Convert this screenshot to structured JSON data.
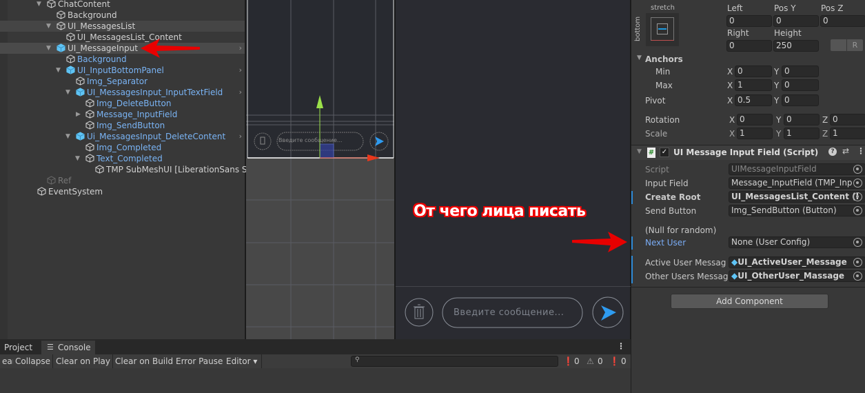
{
  "hierarchy": {
    "items": [
      {
        "label": "ChatContent",
        "depth": 0,
        "expanded": true,
        "prefab": false,
        "color": "normal"
      },
      {
        "label": "Background",
        "depth": 1,
        "prefab": false,
        "color": "normal"
      },
      {
        "label": "UI_MessagesList",
        "depth": 1,
        "expanded": true,
        "prefab": false,
        "color": "normal",
        "hover": true
      },
      {
        "label": "UI_MessagesList_Content",
        "depth": 2,
        "prefab": false,
        "color": "normal"
      },
      {
        "label": "UI_MessageInput",
        "depth": 1,
        "expanded": true,
        "prefab": true,
        "color": "normal",
        "selected": true,
        "chevron": true
      },
      {
        "label": "Background",
        "depth": 2,
        "prefab": false,
        "color": "blue"
      },
      {
        "label": "UI_InputBottomPanel",
        "depth": 2,
        "expanded": true,
        "prefab": true,
        "color": "blue",
        "chevron": true
      },
      {
        "label": "Img_Separator",
        "depth": 3,
        "prefab": false,
        "color": "blue"
      },
      {
        "label": "UI_MessagesInput_InputTextField",
        "depth": 3,
        "expanded": true,
        "prefab": true,
        "color": "blue",
        "chevron": true
      },
      {
        "label": "Img_DeleteButton",
        "depth": 4,
        "prefab": false,
        "color": "blue"
      },
      {
        "label": "Message_InputField",
        "depth": 4,
        "collapsed": true,
        "prefab": false,
        "color": "blue"
      },
      {
        "label": "Img_SendButton",
        "depth": 4,
        "prefab": false,
        "color": "blue"
      },
      {
        "label": "Ui_MessagesInput_DeleteContent",
        "depth": 3,
        "expanded": true,
        "prefab": true,
        "color": "blue",
        "chevron": true
      },
      {
        "label": "Img_Completed",
        "depth": 4,
        "prefab": false,
        "color": "blue"
      },
      {
        "label": "Text_Completed",
        "depth": 4,
        "expanded": true,
        "prefab": false,
        "color": "blue"
      },
      {
        "label": "TMP SubMeshUI [LiberationSans SI",
        "depth": 5,
        "prefab": false,
        "color": "normal"
      },
      {
        "label": "Ref",
        "depth": 0,
        "prefab": false,
        "color": "dim"
      },
      {
        "label": "EventSystem",
        "depth": -1,
        "prefab": false,
        "color": "normal"
      }
    ]
  },
  "scene": {
    "placeholder": "Введите сообщение..."
  },
  "game": {
    "placeholder": "Введите сообщение..."
  },
  "annotation": {
    "text": "От чего лица писать"
  },
  "inspector": {
    "anchor_preset": {
      "horizontal": "stretch",
      "vertical": "bottom"
    },
    "rect": {
      "left_label": "Left",
      "left": "0",
      "posy_label": "Pos Y",
      "posy": "0",
      "posz_label": "Pos Z",
      "posz": "0",
      "right_label": "Right",
      "right": "0",
      "height_label": "Height",
      "height": "250",
      "r_button": "R"
    },
    "anchors": {
      "label": "Anchors",
      "min_label": "Min",
      "min_x": "0",
      "min_y": "0",
      "max_label": "Max",
      "max_x": "1",
      "max_y": "0"
    },
    "pivot": {
      "label": "Pivot",
      "x": "0.5",
      "y": "0"
    },
    "rotation": {
      "label": "Rotation",
      "x": "0",
      "y": "0",
      "z": "0"
    },
    "scale": {
      "label": "Scale",
      "x": "1",
      "y": "1",
      "z": "1"
    },
    "axis": {
      "x": "X",
      "y": "Y",
      "z": "Z"
    },
    "component": {
      "title": "UI Message Input Field (Script)",
      "enabled": true,
      "fields": [
        {
          "label": "Script",
          "value": "UIMessageInputField",
          "dim": true
        },
        {
          "label": "Input Field",
          "value": "Message_InputField (TMP_Inp"
        },
        {
          "label": "Create Root",
          "value": "UI_MessagesList_Content (I",
          "bold": true,
          "marked": true
        },
        {
          "label": "Send Button",
          "value": "Img_SendButton (Button)"
        }
      ],
      "note": "(Null for random)",
      "next_user": {
        "label": "Next User",
        "value": "None (User Config)"
      },
      "messages": [
        {
          "label": "Active User Messag",
          "value": "UI_ActiveUser_Message"
        },
        {
          "label": "Other Users Messag",
          "value": "UI_OtherUser_Massage"
        }
      ]
    },
    "add_component": "Add Component"
  },
  "bottom": {
    "tabs": [
      "Project",
      "Console"
    ],
    "toolbar": [
      "ear",
      "Collapse",
      "Clear on Play",
      "Clear on Build",
      "Error Pause",
      "Editor"
    ],
    "counts": {
      "log": "0",
      "warn": "0",
      "error": "0"
    },
    "search_placeholder": ""
  }
}
